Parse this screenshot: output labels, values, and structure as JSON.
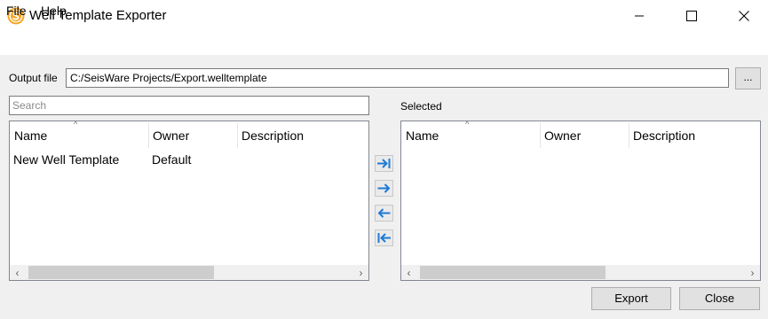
{
  "window": {
    "title": "Well Template Exporter",
    "icon": "seisware-logo-icon",
    "controls": [
      "minimize-icon",
      "maximize-icon",
      "close-icon"
    ]
  },
  "menu": {
    "file": "File",
    "help": "Help"
  },
  "output": {
    "label": "Output file",
    "path": "C:/SeisWare Projects/Export.welltemplate",
    "browse_label": "..."
  },
  "search": {
    "placeholder": "Search"
  },
  "available_table": {
    "columns": [
      "Name",
      "Owner",
      "Description"
    ],
    "rows": [
      {
        "name": "New Well Template",
        "owner": "Default",
        "description": ""
      }
    ]
  },
  "selected_table": {
    "label": "Selected",
    "columns": [
      "Name",
      "Owner",
      "Description"
    ],
    "rows": []
  },
  "transfer_buttons": [
    "add-all-icon",
    "add-selected-icon",
    "remove-selected-icon",
    "remove-all-icon"
  ],
  "buttons": {
    "export": "Export",
    "close": "Close"
  },
  "colors": {
    "logo_orange": "#f5a623",
    "arrow_blue": "#1e7ad6"
  }
}
